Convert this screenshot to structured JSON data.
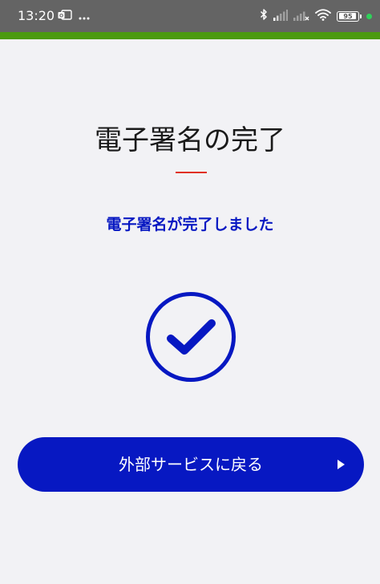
{
  "status_bar": {
    "time": "13:20",
    "battery_level": "95",
    "icons": [
      "notification-app-icon",
      "more-dots-icon",
      "bluetooth-icon",
      "signal-icon",
      "signal-no-service-icon",
      "wifi-icon",
      "battery-icon",
      "charging-dot-icon"
    ]
  },
  "colors": {
    "accent_bar": "#4c9a10",
    "title_underline": "#e0301c",
    "primary_blue": "#0718c2",
    "background": "#f2f2f5"
  },
  "page": {
    "title": "電子署名の完了",
    "subtitle": "電子署名が完了しました"
  },
  "completion_icon": "checkmark-circle-icon",
  "return_button": {
    "label": "外部サービスに戻る",
    "icon": "play-arrow-icon"
  }
}
